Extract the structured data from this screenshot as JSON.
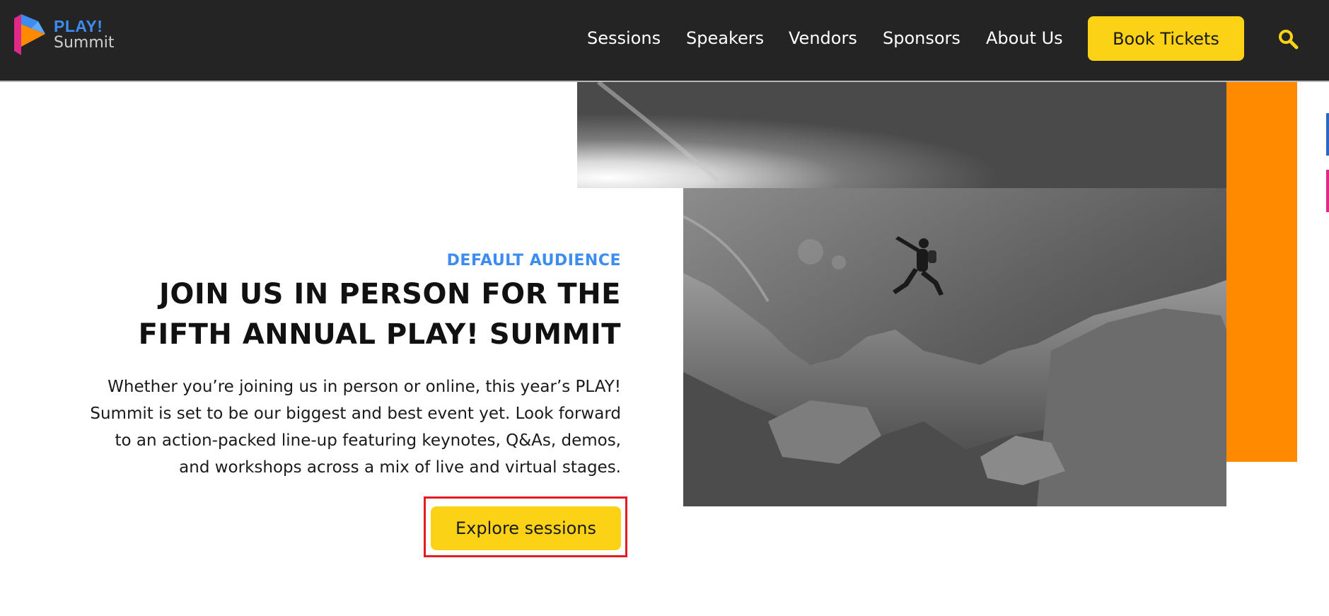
{
  "header": {
    "logo": {
      "line1": "PLAY!",
      "line2": "Summit"
    },
    "nav": [
      {
        "label": "Sessions"
      },
      {
        "label": "Speakers"
      },
      {
        "label": "Vendors"
      },
      {
        "label": "Sponsors"
      },
      {
        "label": "About Us"
      }
    ],
    "cta_label": "Book Tickets",
    "search_icon": "search-icon"
  },
  "hero": {
    "eyebrow": "DEFAULT AUDIENCE",
    "headline_line1": "JOIN US IN PERSON FOR THE",
    "headline_line2": "FIFTH ANNUAL PLAY! SUMMIT",
    "body_lines": [
      "Whether you’re joining us in person or online, this year’s PLAY!",
      "Summit is set to be our biggest and best event yet. Look forward",
      "to an action-packed line-up featuring keynotes, Q&As, demos,",
      "and workshops across a mix of live and virtual stages."
    ],
    "cta_label": "Explore sessions"
  },
  "colors": {
    "topbar": "#242424",
    "accent_yellow": "#fbd216",
    "accent_blue": "#3d8cf0",
    "accent_orange": "#ff8a00",
    "highlight_red": "#e31b23"
  }
}
